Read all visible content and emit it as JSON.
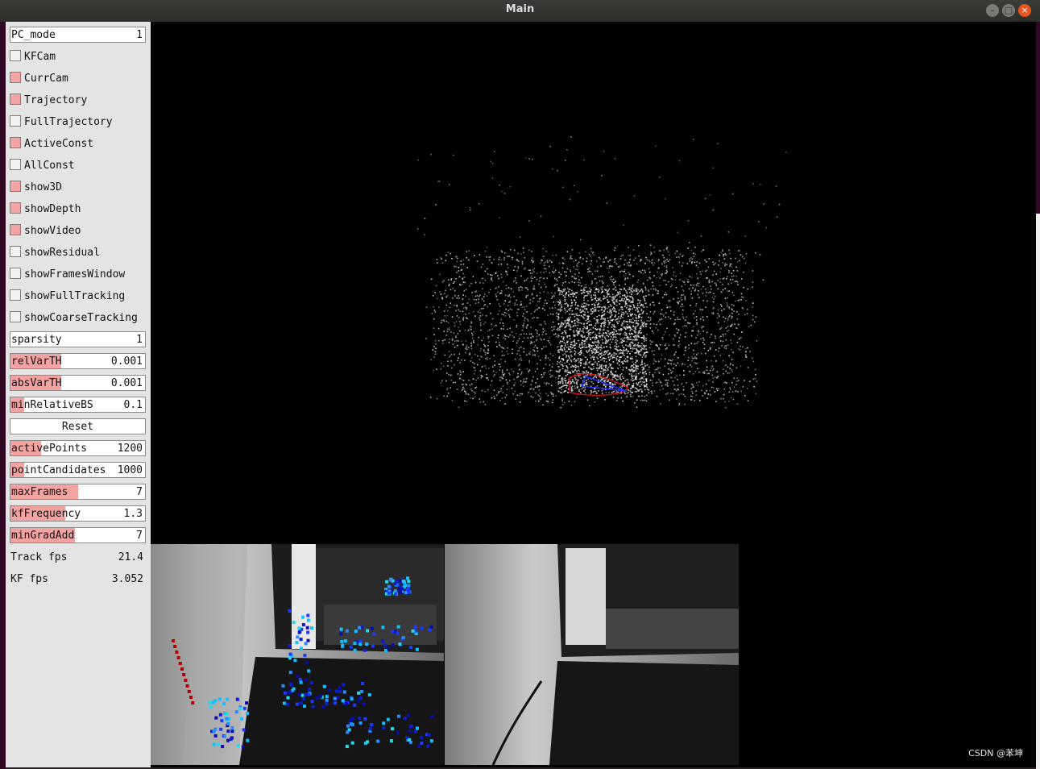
{
  "window": {
    "title": "Main"
  },
  "panel": {
    "pc_mode": {
      "label": "PC_mode",
      "value": "1"
    },
    "checkboxes": [
      {
        "label": "KFCam",
        "checked": false
      },
      {
        "label": "CurrCam",
        "checked": true
      },
      {
        "label": "Trajectory",
        "checked": true
      },
      {
        "label": "FullTrajectory",
        "checked": false
      },
      {
        "label": "ActiveConst",
        "checked": true
      },
      {
        "label": "AllConst",
        "checked": false
      },
      {
        "label": "show3D",
        "checked": true
      },
      {
        "label": "showDepth",
        "checked": true
      },
      {
        "label": "showVideo",
        "checked": true
      },
      {
        "label": "showResidual",
        "checked": false
      },
      {
        "label": "showFramesWindow",
        "checked": false
      },
      {
        "label": "showFullTracking",
        "checked": false
      },
      {
        "label": "showCoarseTracking",
        "checked": false
      }
    ],
    "sparsity": {
      "label": "sparsity",
      "value": "1"
    },
    "sliders1": [
      {
        "label": "relVarTH",
        "value": "0.001",
        "fraction": 0.38
      },
      {
        "label": "absVarTH",
        "value": "0.001",
        "fraction": 0.38
      },
      {
        "label": "minRelativeBS",
        "value": "0.1",
        "fraction": 0.1
      }
    ],
    "reset_label": "Reset",
    "sliders2": [
      {
        "label": "activePoints",
        "value": "1200",
        "fraction": 0.23
      },
      {
        "label": "pointCandidates",
        "value": "1000",
        "fraction": 0.1
      },
      {
        "label": "maxFrames",
        "value": "7",
        "fraction": 0.5
      },
      {
        "label": "kfFrequency",
        "value": "1.3",
        "fraction": 0.41
      },
      {
        "label": "minGradAdd",
        "value": "7",
        "fraction": 0.48
      }
    ],
    "stats": [
      {
        "label": "Track fps",
        "value": "21.4"
      },
      {
        "label": "KF fps",
        "value": "3.052"
      }
    ]
  },
  "watermark": "CSDN @苯坤",
  "colors": {
    "slider_fill": "#f4a3a3",
    "close_button": "#e95420",
    "trajectory": "#e01010",
    "camera": "#2030ff"
  }
}
